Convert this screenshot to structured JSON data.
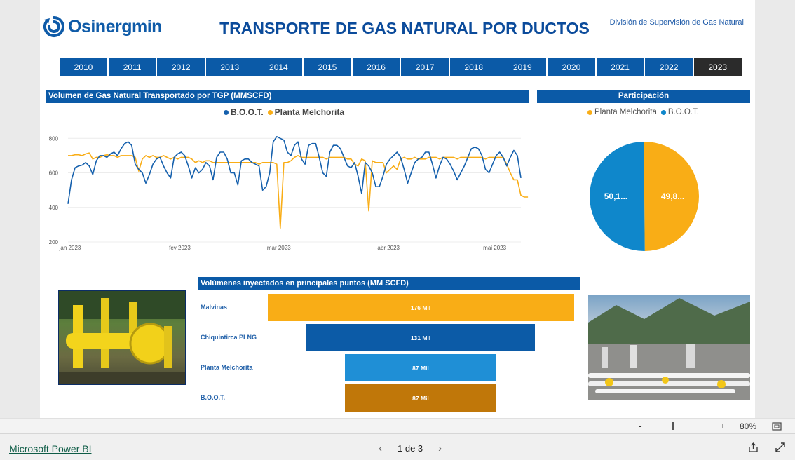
{
  "header": {
    "brand": "Osinergmin",
    "title": "TRANSPORTE DE GAS NATURAL POR DUCTOS",
    "division": "División de Supervisión de Gas Natural"
  },
  "years": [
    "2010",
    "2011",
    "2012",
    "2013",
    "2014",
    "2015",
    "2016",
    "2017",
    "2018",
    "2019",
    "2020",
    "2021",
    "2022",
    "2023"
  ],
  "selected_year": "2023",
  "line_section": {
    "title": "Volumen de Gas Natural Transportado por TGP (MMSCFD)"
  },
  "pie_section": {
    "title": "Participación"
  },
  "funnel_section": {
    "title": "Volúmenes inyectados en principales puntos (MM SCFD)"
  },
  "colors": {
    "boot": "#1560ad",
    "melchorita": "#f9ad16",
    "header": "#0b5aa7"
  },
  "chart_data": [
    {
      "type": "line",
      "title": "Volumen de Gas Natural Transportado por TGP (MMSCFD)",
      "ylim": [
        200,
        850
      ],
      "yticks": [
        "200",
        "400",
        "600",
        "800"
      ],
      "xticks": [
        {
          "label": "jan 2023",
          "day": 0
        },
        {
          "label": "fev 2023",
          "day": 31
        },
        {
          "label": "mar 2023",
          "day": 59
        },
        {
          "label": "abr 2023",
          "day": 90
        },
        {
          "label": "mai 2023",
          "day": 120
        }
      ],
      "series": [
        {
          "name": "B.O.O.T.",
          "color": "#1560ad",
          "values": [
            420,
            560,
            630,
            640,
            645,
            660,
            640,
            590,
            670,
            700,
            700,
            690,
            710,
            720,
            700,
            740,
            770,
            780,
            760,
            650,
            620,
            600,
            540,
            590,
            650,
            680,
            690,
            640,
            600,
            570,
            690,
            710,
            720,
            700,
            640,
            570,
            630,
            600,
            620,
            660,
            640,
            560,
            690,
            720,
            720,
            680,
            600,
            600,
            530,
            670,
            680,
            680,
            660,
            650,
            640,
            500,
            520,
            600,
            780,
            810,
            800,
            790,
            720,
            700,
            760,
            780,
            680,
            650,
            760,
            770,
            770,
            690,
            600,
            580,
            720,
            760,
            760,
            740,
            690,
            640,
            630,
            660,
            580,
            480,
            660,
            640,
            600,
            520,
            520,
            580,
            650,
            680,
            700,
            720,
            690,
            620,
            540,
            600,
            660,
            680,
            690,
            720,
            720,
            650,
            570,
            640,
            690,
            680,
            650,
            610,
            560,
            600,
            640,
            690,
            740,
            750,
            740,
            700,
            620,
            600,
            650,
            700,
            720,
            690,
            640,
            690,
            730,
            700,
            570
          ]
        },
        {
          "name": "Planta Melchorita",
          "color": "#f9ad16",
          "values": [
            700,
            700,
            705,
            705,
            700,
            710,
            715,
            680,
            690,
            690,
            700,
            705,
            700,
            700,
            690,
            700,
            700,
            700,
            700,
            690,
            610,
            680,
            700,
            690,
            700,
            690,
            690,
            700,
            690,
            680,
            690,
            680,
            690,
            690,
            690,
            680,
            660,
            670,
            660,
            670,
            670,
            660,
            660,
            660,
            660,
            660,
            660,
            660,
            660,
            660,
            660,
            660,
            660,
            660,
            650,
            660,
            660,
            660,
            660,
            650,
            280,
            660,
            660,
            670,
            690,
            700,
            690,
            690,
            690,
            690,
            690,
            690,
            690,
            680,
            690,
            690,
            690,
            690,
            690,
            680,
            680,
            650,
            640,
            680,
            670,
            380,
            670,
            660,
            660,
            660,
            600,
            620,
            640,
            620,
            680,
            690,
            680,
            680,
            690,
            680,
            680,
            680,
            690,
            690,
            690,
            680,
            690,
            690,
            690,
            690,
            680,
            690,
            690,
            690,
            690,
            690,
            690,
            690,
            680,
            690,
            690,
            690,
            690,
            690,
            650,
            600,
            560,
            560,
            470,
            460,
            460
          ]
        }
      ]
    },
    {
      "type": "pie",
      "title": "Participación",
      "legend": [
        "Planta Melchorita",
        "B.O.O.T."
      ],
      "slices": [
        {
          "name": "Planta Melchorita",
          "value": 49.8,
          "label": "49,8...",
          "color": "#f9ad16"
        },
        {
          "name": "B.O.O.T.",
          "value": 50.1,
          "label": "50,1...",
          "color": "#0f87cb"
        }
      ]
    },
    {
      "type": "bar",
      "title": "Volúmenes inyectados en principales puntos (MM SCFD)",
      "categories": [
        "Malvinas",
        "Chiquintirca PLNG",
        "Planta Melchorita",
        "B.O.O.T."
      ],
      "values": [
        176,
        131,
        87,
        87
      ],
      "labels": [
        "176 Mil",
        "131 Mil",
        "87 Mil",
        "87 Mil"
      ],
      "colors": [
        "#f9ad16",
        "#0c5ba7",
        "#1f8fd6",
        "#c07709"
      ]
    }
  ],
  "zoom": {
    "minus": "-",
    "plus": "+",
    "level": "80%"
  },
  "footer": {
    "brand_link": "Microsoft Power BI",
    "pager": "1 de 3",
    "prev": "‹",
    "next": "›"
  }
}
